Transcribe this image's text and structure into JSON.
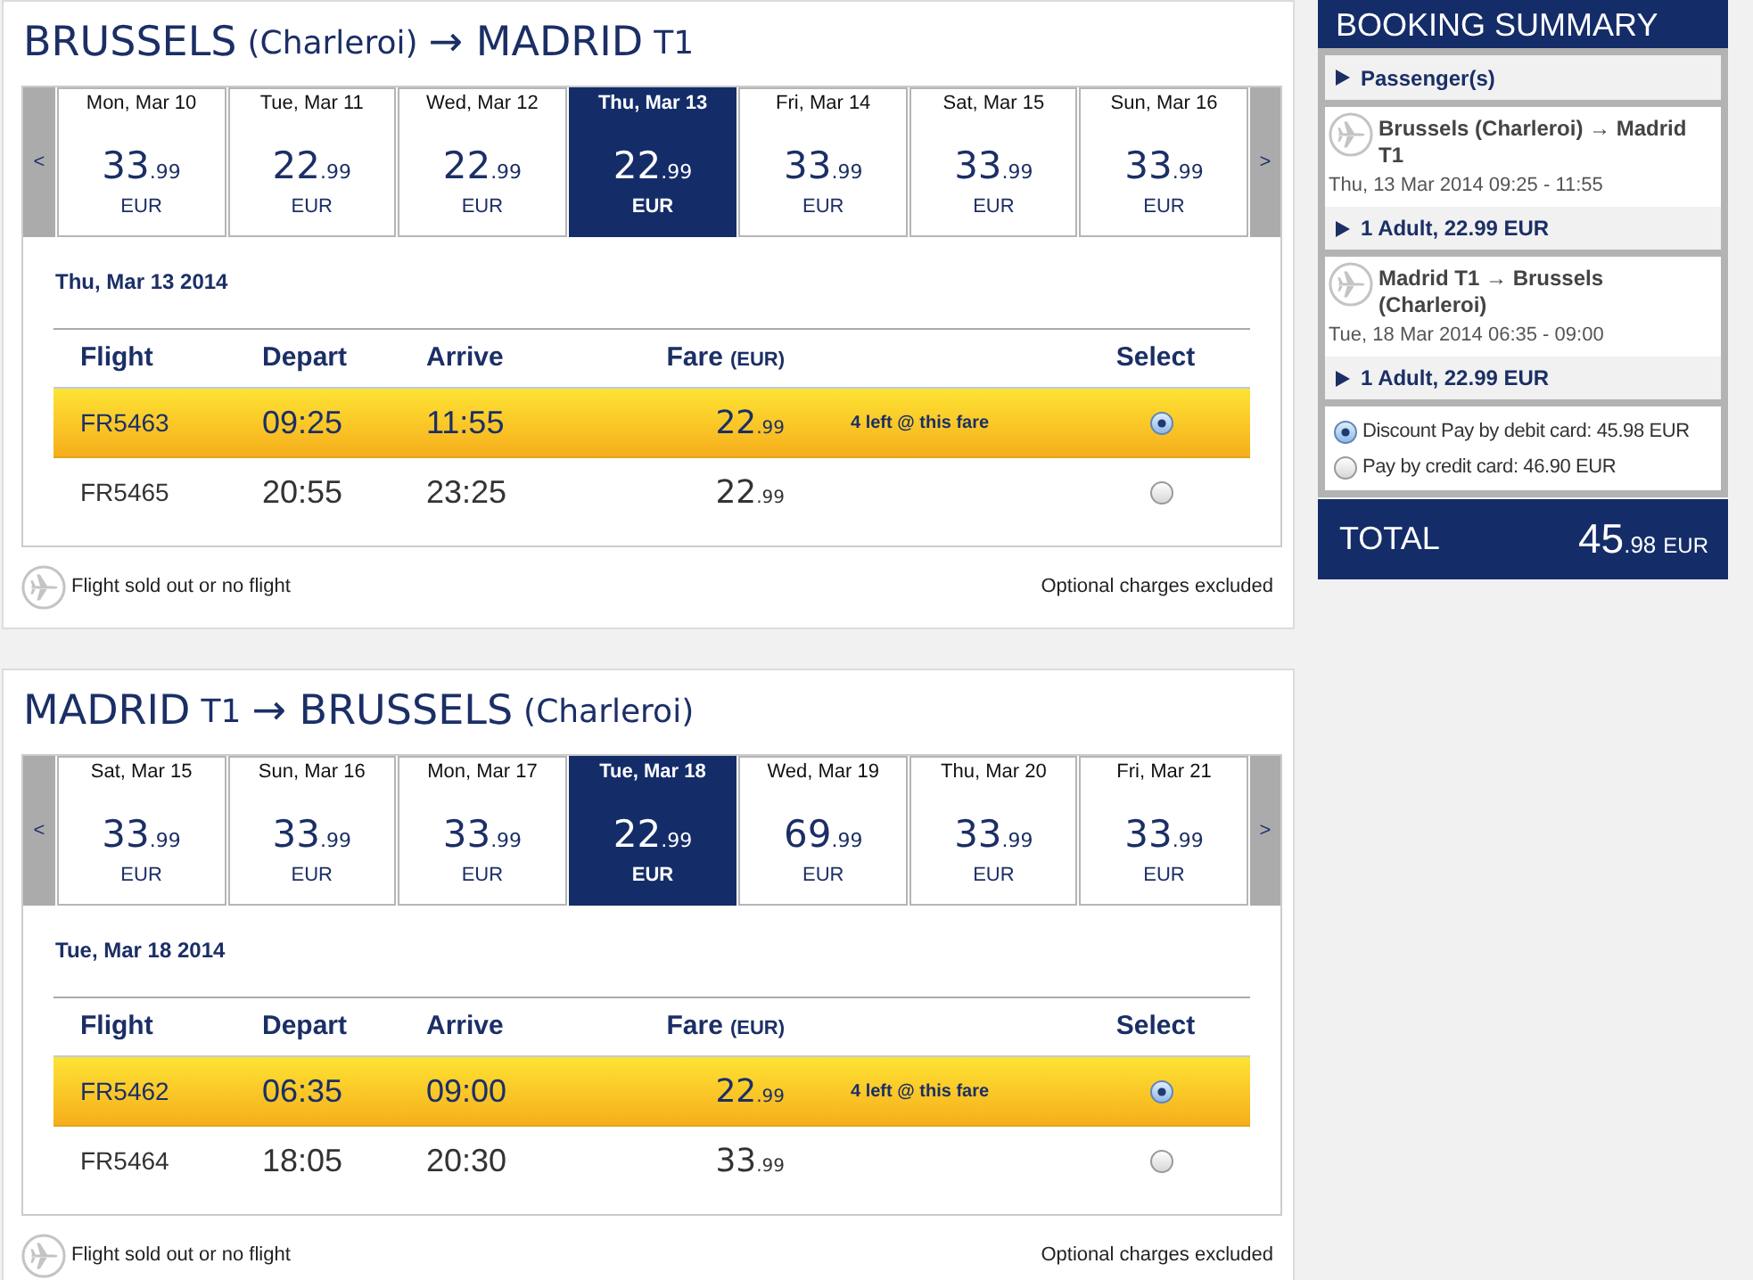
{
  "journeys": [
    {
      "title": [
        {
          "text": "BRUSSELS",
          "kind": "main"
        },
        {
          "text": "(Charleroi)",
          "kind": "note"
        },
        {
          "text": "→ MADRID",
          "kind": "main"
        },
        {
          "text": "T1",
          "kind": "note"
        }
      ],
      "prev": "<",
      "next": ">",
      "dates": [
        {
          "label": "Mon, Mar 10",
          "price": "33",
          "cents": ".99",
          "currency": "EUR",
          "selected": false
        },
        {
          "label": "Tue, Mar 11",
          "price": "22",
          "cents": ".99",
          "currency": "EUR",
          "selected": false
        },
        {
          "label": "Wed, Mar 12",
          "price": "22",
          "cents": ".99",
          "currency": "EUR",
          "selected": false
        },
        {
          "label": "Thu, Mar 13",
          "price": "22",
          "cents": ".99",
          "currency": "EUR",
          "selected": true
        },
        {
          "label": "Fri, Mar 14",
          "price": "33",
          "cents": ".99",
          "currency": "EUR",
          "selected": false
        },
        {
          "label": "Sat, Mar 15",
          "price": "33",
          "cents": ".99",
          "currency": "EUR",
          "selected": false
        },
        {
          "label": "Sun, Mar 16",
          "price": "33",
          "cents": ".99",
          "currency": "EUR",
          "selected": false
        }
      ],
      "day_heading": "Thu, Mar 13 2014",
      "columns": [
        {
          "label": "Flight"
        },
        {
          "label": "Depart"
        },
        {
          "label": "Arrive"
        },
        {
          "label": "Fare",
          "unit": "(EUR)"
        },
        {
          "label": "Select"
        }
      ],
      "flights": [
        {
          "flight": "FR5463",
          "depart": "09:25",
          "arrive": "11:55",
          "fare": "22",
          "cents": ".99",
          "availability": "4 left @ this fare",
          "selected": true
        },
        {
          "flight": "FR5465",
          "depart": "20:55",
          "arrive": "23:25",
          "fare": "22",
          "cents": ".99",
          "selected": false
        }
      ],
      "legend": "Flight sold out or no flight",
      "note": "Optional charges excluded"
    },
    {
      "title": [
        {
          "text": "MADRID",
          "kind": "main"
        },
        {
          "text": "T1",
          "kind": "note"
        },
        {
          "text": "→ BRUSSELS",
          "kind": "main"
        },
        {
          "text": "(Charleroi)",
          "kind": "note"
        }
      ],
      "prev": "<",
      "next": ">",
      "dates": [
        {
          "label": "Sat, Mar 15",
          "price": "33",
          "cents": ".99",
          "currency": "EUR",
          "selected": false
        },
        {
          "label": "Sun, Mar 16",
          "price": "33",
          "cents": ".99",
          "currency": "EUR",
          "selected": false
        },
        {
          "label": "Mon, Mar 17",
          "price": "33",
          "cents": ".99",
          "currency": "EUR",
          "selected": false
        },
        {
          "label": "Tue, Mar 18",
          "price": "22",
          "cents": ".99",
          "currency": "EUR",
          "selected": true
        },
        {
          "label": "Wed, Mar 19",
          "price": "69",
          "cents": ".99",
          "currency": "EUR",
          "selected": false
        },
        {
          "label": "Thu, Mar 20",
          "price": "33",
          "cents": ".99",
          "currency": "EUR",
          "selected": false
        },
        {
          "label": "Fri, Mar 21",
          "price": "33",
          "cents": ".99",
          "currency": "EUR",
          "selected": false
        }
      ],
      "day_heading": "Tue, Mar 18 2014",
      "columns": [
        {
          "label": "Flight"
        },
        {
          "label": "Depart"
        },
        {
          "label": "Arrive"
        },
        {
          "label": "Fare",
          "unit": "(EUR)"
        },
        {
          "label": "Select"
        }
      ],
      "flights": [
        {
          "flight": "FR5462",
          "depart": "06:35",
          "arrive": "09:00",
          "fare": "22",
          "cents": ".99",
          "availability": "4 left @ this fare",
          "selected": true
        },
        {
          "flight": "FR5464",
          "depart": "18:05",
          "arrive": "20:30",
          "fare": "33",
          "cents": ".99",
          "selected": false
        }
      ],
      "legend": "Flight sold out or no flight",
      "note": "Optional charges excluded"
    }
  ],
  "booking_summary": {
    "title": "BOOKING SUMMARY",
    "passengers": "Passenger(s)",
    "flights": [
      {
        "route": "Brussels (Charleroi) → Madrid T1",
        "time": "Thu, 13 Mar 2014 09:25 - 11:55",
        "fare_line": "1 Adult, 22.99 EUR"
      },
      {
        "route": "Madrid T1 → Brussels (Charleroi)",
        "time": "Tue, 18 Mar 2014 06:35 - 09:00",
        "fare_line": "1 Adult, 22.99 EUR"
      }
    ],
    "payment_options": [
      {
        "label": "Discount Pay by debit card: 45.98 EUR",
        "selected": true
      },
      {
        "label": "Pay by credit card: 46.90 EUR",
        "selected": false
      }
    ],
    "total": {
      "label": "TOTAL",
      "amount": "45",
      "cents": ".98",
      "currency": "EUR"
    }
  }
}
